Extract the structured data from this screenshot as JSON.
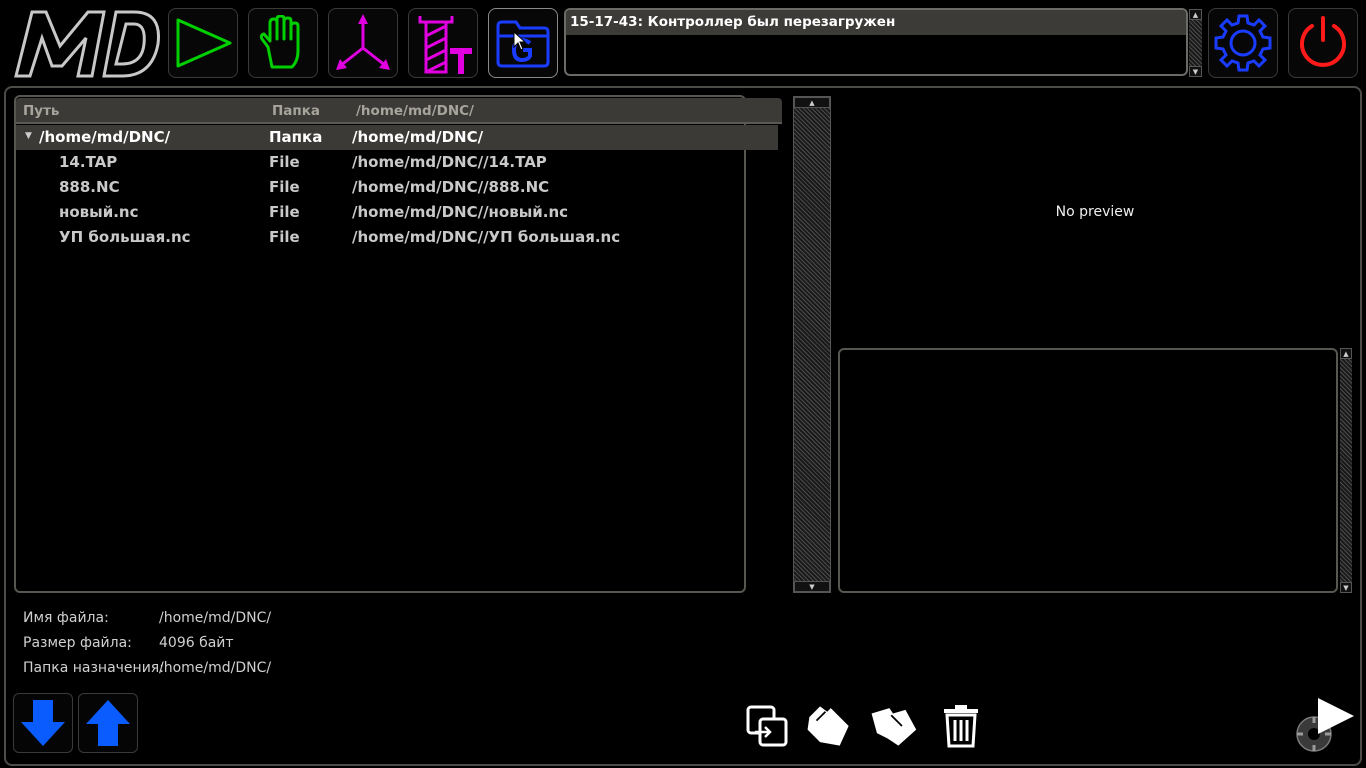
{
  "toolbar": {
    "logo_text": "MD",
    "buttons": [
      {
        "name": "auto-mode",
        "icon": "play-triangle-icon",
        "color": "#00d000"
      },
      {
        "name": "manual-mode",
        "icon": "hand-icon",
        "color": "#00d000"
      },
      {
        "name": "coordinates",
        "icon": "axes-icon",
        "color": "#e000e0"
      },
      {
        "name": "tools",
        "icon": "tool-mill-icon",
        "color": "#e000e0"
      },
      {
        "name": "gcode-files",
        "icon": "folder-g-icon",
        "color": "#1a3cff"
      }
    ],
    "settings_icon": "gear-icon",
    "settings_color": "#1a3cff",
    "power_icon": "power-icon",
    "power_color": "#ff1a1a"
  },
  "messages": {
    "items": [
      "15-17-43: Контроллер был перезагружен"
    ]
  },
  "file_table": {
    "headers": {
      "path": "Путь",
      "folder": "Папка",
      "location": "/home/md/DNC/"
    },
    "rows": [
      {
        "name": "/home/md/DNC/",
        "type": "Папка",
        "full_path": "/home/md/DNC/",
        "selected": true
      },
      {
        "name": "14.TAP",
        "type": "File",
        "full_path": "/home/md/DNC//14.TAP"
      },
      {
        "name": "888.NC",
        "type": "File",
        "full_path": "/home/md/DNC//888.NC"
      },
      {
        "name": "новый.nc",
        "type": "File",
        "full_path": "/home/md/DNC//новый.nc"
      },
      {
        "name": "УП большая.nc",
        "type": "File",
        "full_path": "/home/md/DNC//УП большая.nc"
      }
    ]
  },
  "preview": {
    "empty_text": "No preview"
  },
  "file_info": {
    "name_label": "Имя файла:",
    "name_value": "/home/md/DNC/",
    "size_label": "Размер файла:",
    "size_value": "4096 байт",
    "dest_label": "Папка назначения:",
    "dest_value": "/home/md/DNC/"
  },
  "bottom": {
    "move_down_icon": "arrow-down-icon",
    "move_up_icon": "arrow-up-icon",
    "actions": [
      "copy-icon",
      "cut-icon",
      "paste-icon",
      "trash-icon"
    ],
    "run_icon": "play-gear-icon",
    "accent": "#0a5cff"
  }
}
